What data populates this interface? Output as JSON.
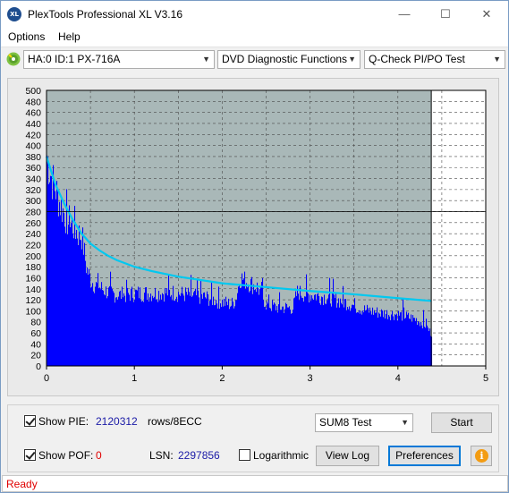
{
  "window": {
    "title": "PlexTools Professional XL V3.16",
    "icon_text": "XL",
    "controls": {
      "minimize": "—",
      "maximize": "☐",
      "close": "✕"
    }
  },
  "menu": {
    "options": "Options",
    "help": "Help"
  },
  "toolbar": {
    "drive": "HA:0 ID:1  PX-716A",
    "function": "DVD Diagnostic Functions",
    "test": "Q-Check PI/PO Test",
    "arrow": "▼"
  },
  "controls_panel": {
    "show_pie_label": "Show PIE:",
    "show_pie_checked": true,
    "pie_value": "2120312",
    "pie_unit": "rows/8ECC",
    "show_pof_label": "Show POF:",
    "show_pof_checked": true,
    "pof_value": "0",
    "lsn_label": "LSN:",
    "lsn_value": "2297856",
    "logarithmic_label": "Logarithmic",
    "logarithmic_checked": false,
    "test_mode": "SUM8 Test",
    "start_button": "Start",
    "view_log_button": "View Log",
    "preferences_button": "Preferences",
    "info_glyph": "i"
  },
  "status": {
    "text": "Ready"
  },
  "colors": {
    "bars": "#0000ff",
    "curve": "#00c8f0",
    "plot_bg": "#a9b8b8",
    "status_text": "#e00000"
  },
  "chart_data": {
    "type": "bar",
    "xlim": [
      0,
      5
    ],
    "ylim": [
      0,
      500
    ],
    "x_ticks": [
      "0",
      "1",
      "2",
      "3",
      "4",
      "5"
    ],
    "y_ticks": [
      "0",
      "20",
      "40",
      "60",
      "80",
      "100",
      "120",
      "140",
      "160",
      "180",
      "200",
      "220",
      "240",
      "260",
      "280",
      "300",
      "320",
      "340",
      "360",
      "380",
      "400",
      "420",
      "440",
      "460",
      "480",
      "500"
    ],
    "data_end_x": 4.38,
    "cursor_x": 4.38,
    "cursor_y": 280,
    "pie_envelope": [
      [
        0.0,
        430
      ],
      [
        0.03,
        400
      ],
      [
        0.06,
        380
      ],
      [
        0.1,
        360
      ],
      [
        0.15,
        330
      ],
      [
        0.2,
        310
      ],
      [
        0.25,
        290
      ],
      [
        0.3,
        285
      ],
      [
        0.35,
        270
      ],
      [
        0.4,
        265
      ],
      [
        0.45,
        200
      ],
      [
        0.5,
        175
      ],
      [
        0.55,
        165
      ],
      [
        0.6,
        160
      ],
      [
        0.7,
        150
      ],
      [
        0.8,
        145
      ],
      [
        0.9,
        145
      ],
      [
        1.0,
        148
      ],
      [
        1.2,
        148
      ],
      [
        1.4,
        150
      ],
      [
        1.6,
        145
      ],
      [
        1.8,
        140
      ],
      [
        2.0,
        130
      ],
      [
        2.1,
        125
      ],
      [
        2.15,
        135
      ],
      [
        2.2,
        180
      ],
      [
        2.3,
        170
      ],
      [
        2.4,
        160
      ],
      [
        2.5,
        125
      ],
      [
        2.6,
        120
      ],
      [
        2.8,
        118
      ],
      [
        2.85,
        150
      ],
      [
        3.0,
        145
      ],
      [
        3.2,
        140
      ],
      [
        3.4,
        130
      ],
      [
        3.6,
        115
      ],
      [
        3.8,
        108
      ],
      [
        4.0,
        105
      ],
      [
        4.1,
        100
      ],
      [
        4.2,
        95
      ],
      [
        4.3,
        85
      ],
      [
        4.38,
        65
      ]
    ],
    "curve": [
      [
        0.0,
        380
      ],
      [
        0.05,
        355
      ],
      [
        0.1,
        330
      ],
      [
        0.2,
        295
      ],
      [
        0.3,
        265
      ],
      [
        0.4,
        240
      ],
      [
        0.5,
        222
      ],
      [
        0.6,
        210
      ],
      [
        0.7,
        200
      ],
      [
        0.8,
        192
      ],
      [
        1.0,
        180
      ],
      [
        1.2,
        172
      ],
      [
        1.5,
        162
      ],
      [
        2.0,
        150
      ],
      [
        2.5,
        143
      ],
      [
        3.0,
        136
      ],
      [
        3.5,
        130
      ],
      [
        4.0,
        123
      ],
      [
        4.38,
        118
      ]
    ]
  }
}
